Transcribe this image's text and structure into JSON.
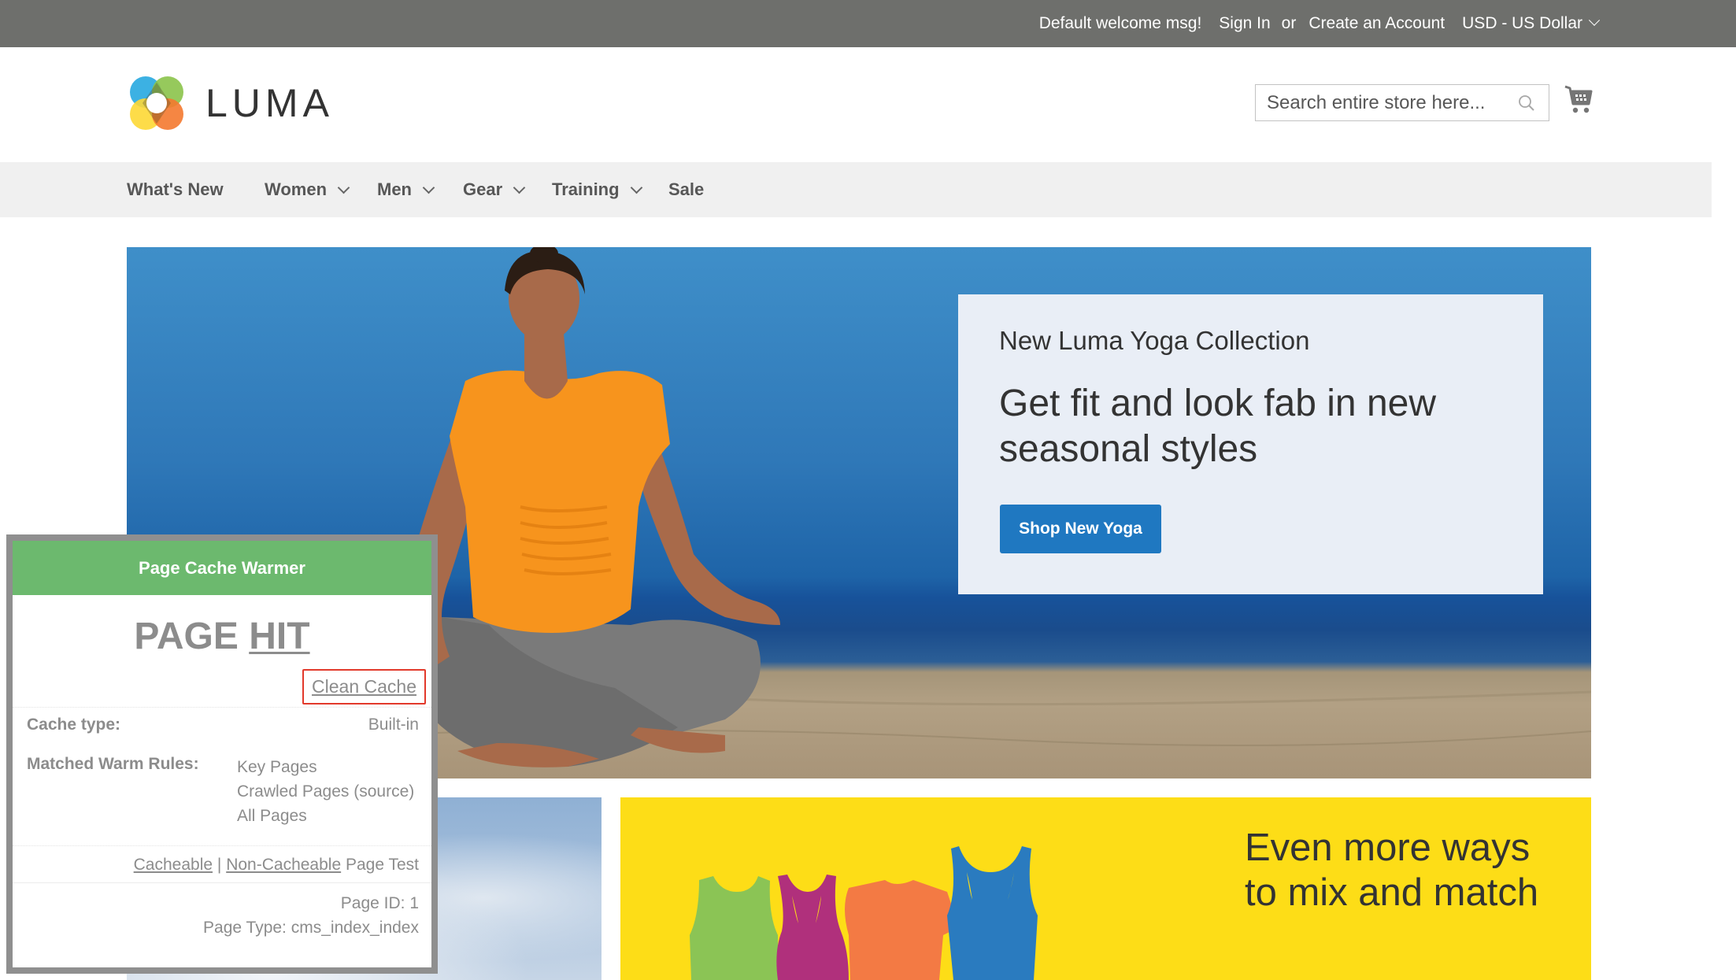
{
  "topbar": {
    "welcome": "Default welcome msg!",
    "sign_in": "Sign In",
    "or": "or",
    "create_account": "Create an Account",
    "currency": "USD - US Dollar"
  },
  "header": {
    "logo_text": "LUMA",
    "search": {
      "placeholder": "Search entire store here...",
      "value": ""
    },
    "icons": {
      "search": "magnifier-icon",
      "cart": "shopping-cart-icon"
    }
  },
  "nav": {
    "items": [
      {
        "label": "What's New",
        "has_dropdown": false
      },
      {
        "label": "Women",
        "has_dropdown": true
      },
      {
        "label": "Men",
        "has_dropdown": true
      },
      {
        "label": "Gear",
        "has_dropdown": true
      },
      {
        "label": "Training",
        "has_dropdown": true
      },
      {
        "label": "Sale",
        "has_dropdown": false
      }
    ]
  },
  "hero": {
    "subtitle": "New Luma Yoga Collection",
    "headline": "Get fit and look fab in new seasonal styles",
    "cta": "Shop New Yoga",
    "colors": {
      "cta": "#1f78c1",
      "promo_bg": "#e9eef6"
    }
  },
  "promo_mix": {
    "line1": "Even more ways",
    "line2": "to mix and match",
    "colors": {
      "background": "#fddd17",
      "green": "#8bc455",
      "magenta": "#b0307c",
      "orange": "#f37a44",
      "blue": "#2a7bbf"
    }
  },
  "cache_panel": {
    "title": "Page Cache Warmer",
    "status_word1": "PAGE",
    "status_word2": "HIT",
    "clean_cache": "Clean Cache",
    "cache_type_label": "Cache type:",
    "cache_type_value": "Built-in",
    "rules_label": "Matched Warm Rules:",
    "rules": [
      "Key Pages",
      "Crawled Pages (source)",
      "All Pages"
    ],
    "test_cacheable": "Cacheable",
    "test_separator": "|",
    "test_non_cacheable": "Non-Cacheable",
    "test_suffix": "Page Test",
    "page_id": "Page ID: 1",
    "page_type": "Page Type: cms_index_index",
    "colors": {
      "header": "#6cb96e",
      "border": "#8f8f8f",
      "highlight": "#e2392b"
    }
  }
}
